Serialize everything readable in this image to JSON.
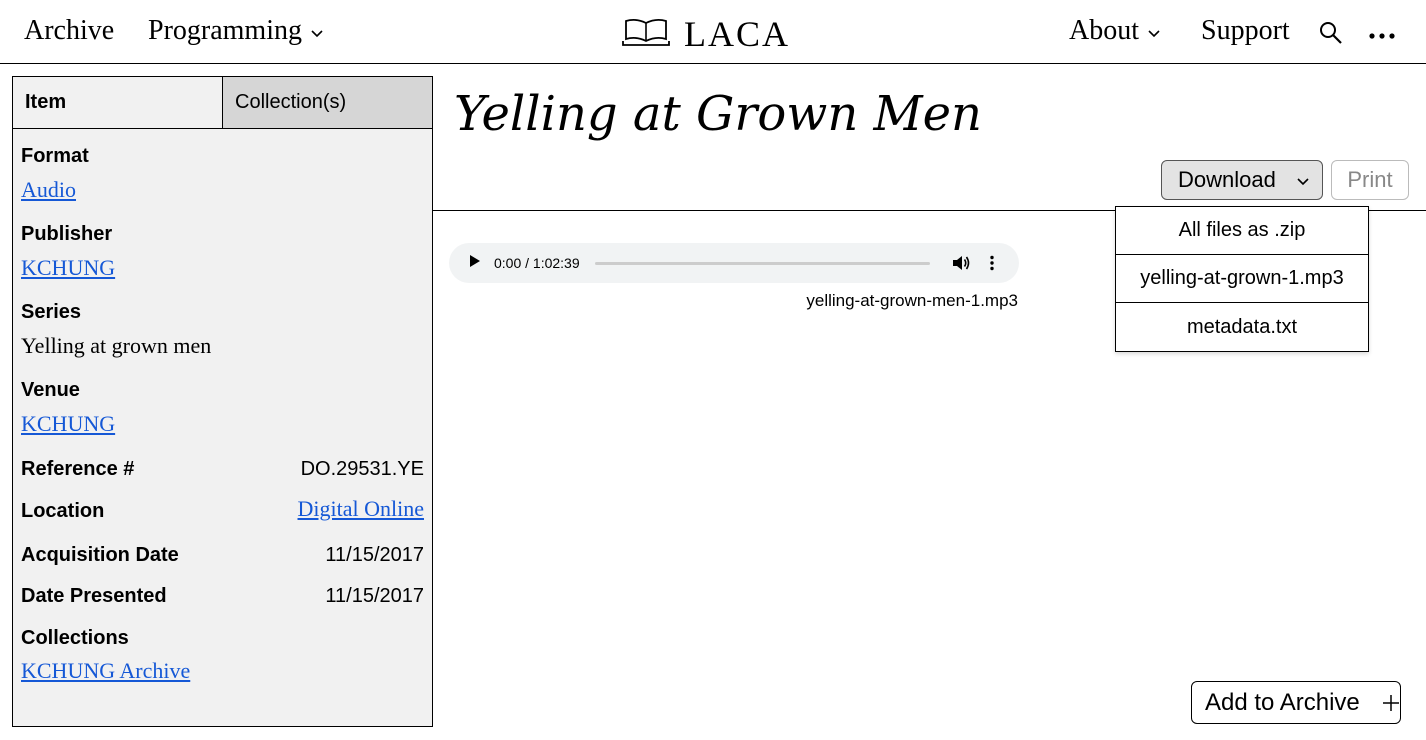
{
  "nav": {
    "archive": "Archive",
    "programming": "Programming",
    "logo_text": "LACA",
    "about": "About",
    "support": "Support"
  },
  "sidebar": {
    "tabs": {
      "item": "Item",
      "collections": "Collection(s)"
    },
    "format_label": "Format",
    "format_value": "Audio",
    "publisher_label": "Publisher",
    "publisher_value": "KCHUNG",
    "series_label": "Series",
    "series_value": "Yelling at grown men",
    "venue_label": "Venue",
    "venue_value": "KCHUNG",
    "reference_label": "Reference #",
    "reference_value": "DO.29531.YE",
    "location_label": "Location",
    "location_value": "Digital Online",
    "acquisition_label": "Acquisition Date",
    "acquisition_value": "11/15/2017",
    "presented_label": "Date Presented",
    "presented_value": "11/15/2017",
    "collections_label": "Collections",
    "collections_value": "KCHUNG Archive"
  },
  "main": {
    "title": "Yelling at Grown Men",
    "download_label": "Download",
    "print_label": "Print",
    "download_menu": [
      "All files as .zip",
      "yelling-at-grown-1.mp3",
      "metadata.txt"
    ],
    "player_time": "0:00 / 1:02:39",
    "player_filename": "yelling-at-grown-men-1.mp3",
    "add_to_archive_label": "Add to Archive"
  },
  "colors": {
    "link": "#1558d6",
    "sidebar_bg": "#f1f1f1",
    "tab_inactive_bg": "#d6d6d6"
  }
}
